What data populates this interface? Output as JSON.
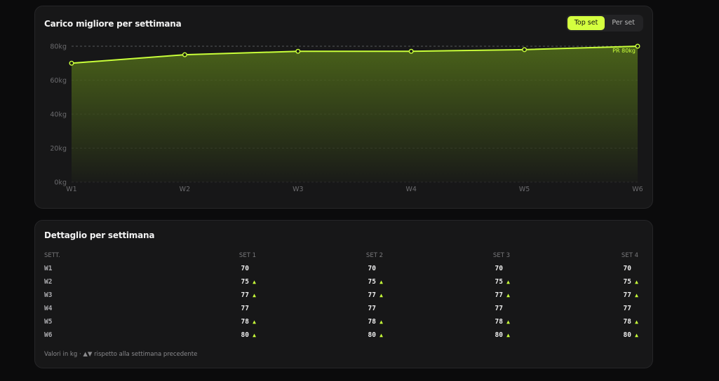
{
  "chart_card": {
    "title": "Carico migliore per settimana",
    "toggle": {
      "options": [
        "Top set",
        "Per set"
      ],
      "selected": "Top set"
    }
  },
  "chart_data": {
    "type": "area",
    "categories": [
      "W1",
      "W2",
      "W3",
      "W4",
      "W5",
      "W6"
    ],
    "series": [
      {
        "values": [
          70,
          75,
          77,
          77,
          78,
          80
        ]
      }
    ],
    "ylim": [
      0,
      80
    ],
    "y_ticks": [
      "0kg",
      "20kg",
      "40kg",
      "60kg",
      "80kg"
    ],
    "y_tick_values": [
      0,
      20,
      40,
      60,
      80
    ],
    "pr_line": {
      "value": 80,
      "label": "PR 80kg"
    },
    "grid": true,
    "line_color": "#c9ff3a",
    "area_color": "#5a7a1a"
  },
  "table_card": {
    "title": "Dettaglio per settimana",
    "headers": [
      "SETT.",
      "SET 1",
      "SET 2",
      "SET 3",
      "SET 4"
    ],
    "rows": [
      {
        "week": "W1",
        "sets": [
          "70",
          "70",
          "70",
          "70"
        ],
        "trend": "none"
      },
      {
        "week": "W2",
        "sets": [
          "75",
          "75",
          "75",
          "75"
        ],
        "trend": "up"
      },
      {
        "week": "W3",
        "sets": [
          "77",
          "77",
          "77",
          "77"
        ],
        "trend": "up"
      },
      {
        "week": "W4",
        "sets": [
          "77",
          "77",
          "77",
          "77"
        ],
        "trend": "none"
      },
      {
        "week": "W5",
        "sets": [
          "78",
          "78",
          "78",
          "78"
        ],
        "trend": "up"
      },
      {
        "week": "W6",
        "sets": [
          "80",
          "80",
          "80",
          "80"
        ],
        "trend": "up"
      }
    ],
    "up_symbol": "▲",
    "footnote": "Valori in kg · ▲▼ rispetto alla settimana precedente"
  }
}
